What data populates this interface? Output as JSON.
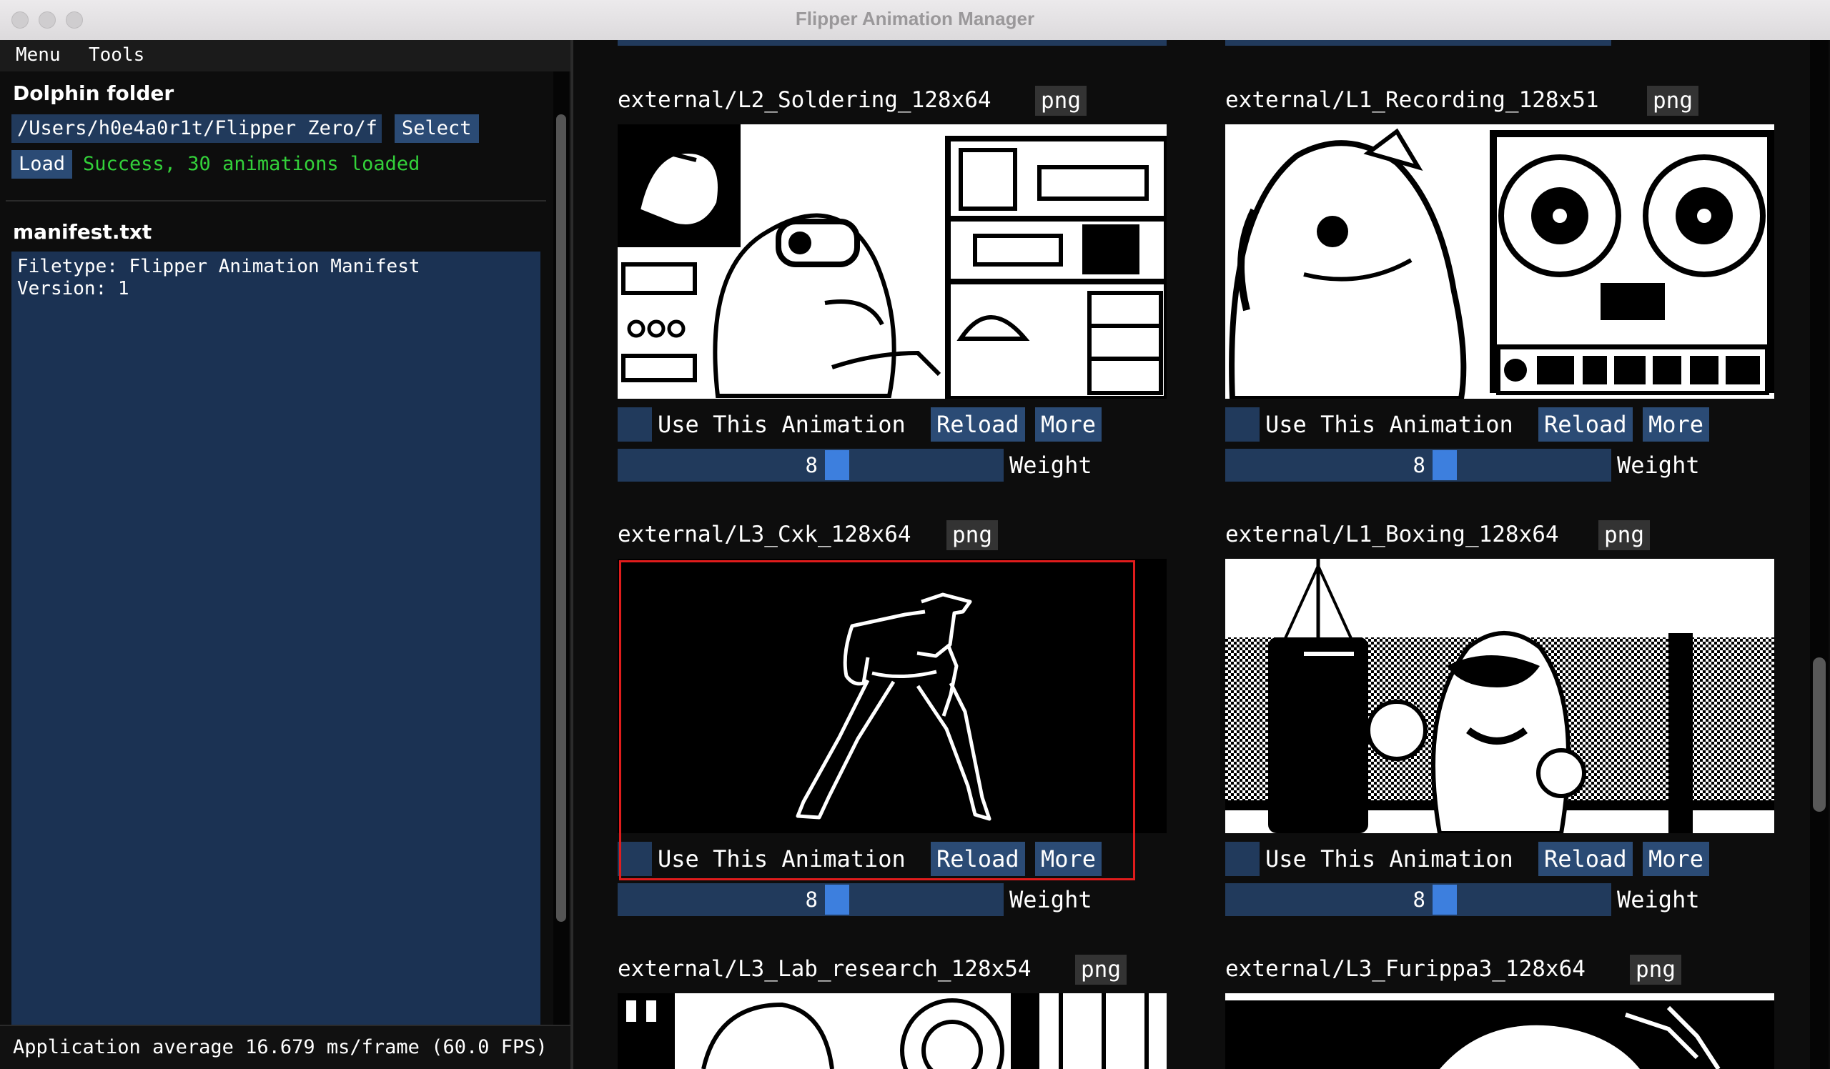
{
  "window": {
    "title": "Flipper Animation Manager"
  },
  "menu": {
    "items": [
      "Menu",
      "Tools"
    ]
  },
  "dolphin": {
    "heading": "Dolphin folder",
    "path_value": "/Users/h0e4a0r1t/Flipper Zero/f",
    "select_label": "Select",
    "load_label": "Load",
    "status": "Success, 30 animations loaded"
  },
  "manifest": {
    "heading": "manifest.txt",
    "content": "Filetype: Flipper Animation Manifest\nVersion: 1"
  },
  "footer": {
    "text": "Application average 16.679 ms/frame (60.0 FPS)"
  },
  "colors": {
    "accent": "#2b4b75",
    "field": "#213a5c",
    "grab": "#3d7fde",
    "success": "#33d13a",
    "selected": "#e01c1c"
  },
  "cards": [
    {
      "name": "external/L2_Soldering_128x64",
      "format": "png",
      "use_label": "Use This Animation",
      "reload_label": "Reload",
      "more_label": "More",
      "weight": "8",
      "weight_label": "Weight",
      "checked": false,
      "selected": false
    },
    {
      "name": "external/L1_Recording_128x51",
      "format": "png",
      "use_label": "Use This Animation",
      "reload_label": "Reload",
      "more_label": "More",
      "weight": "8",
      "weight_label": "Weight",
      "checked": false,
      "selected": false
    },
    {
      "name": "external/L3_Cxk_128x64",
      "format": "png",
      "use_label": "Use This Animation",
      "reload_label": "Reload",
      "more_label": "More",
      "weight": "8",
      "weight_label": "Weight",
      "checked": false,
      "selected": true
    },
    {
      "name": "external/L1_Boxing_128x64",
      "format": "png",
      "use_label": "Use This Animation",
      "reload_label": "Reload",
      "more_label": "More",
      "weight": "8",
      "weight_label": "Weight",
      "checked": false,
      "selected": false
    },
    {
      "name": "external/L3_Lab_research_128x54",
      "format": "png"
    },
    {
      "name": "external/L3_Furippa3_128x64",
      "format": "png"
    }
  ]
}
